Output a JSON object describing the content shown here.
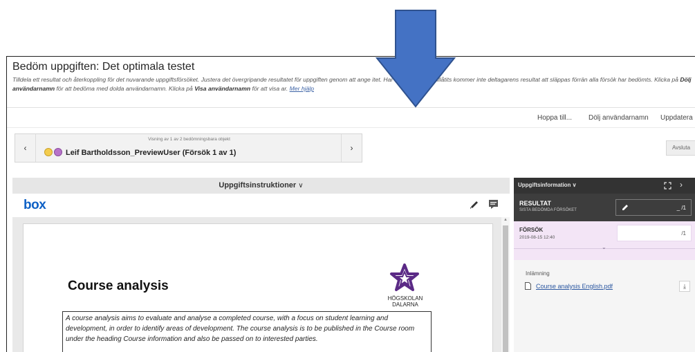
{
  "header": {
    "title": "Bedöm uppgiften: Det optimala testet",
    "description": {
      "part1": "Tilldela ett resultat och återkoppling för det nuvarande uppgiftsförsöket. Justera det övergripande resultatet för uppgiften genom att ange ",
      "part2": "itet. Har flera testförsök tillåtits kommer inte deltagarens resultat att släppas förrän alla försök har bedömts. Klicka på ",
      "bold1": "Dölj användarnamn",
      "part3": " för att bedöma med dolda användarnamn. Klicka på ",
      "bold2": "Visa användarnamn",
      "part4": " för att visa a",
      "part5": "r. ",
      "help_link": "Mer hjälp"
    }
  },
  "toolbar": {
    "jump_to": "Hoppa till...",
    "hide_names": "Dölj användarnamn",
    "update": "Uppdatera"
  },
  "navigator": {
    "count_text": "Visning av 1 av 2 bedömningsbara objekt",
    "user": "Leif Bartholdsson_PreviewUser (Försök 1 av 1)",
    "prev_glyph": "‹",
    "next_glyph": "›"
  },
  "finish_button": "Avsluta",
  "instructions": {
    "label": "Uppgiftsinstruktioner",
    "caret": "∨"
  },
  "viewer": {
    "logo": "box",
    "document": {
      "title": "Course analysis",
      "logo_text_line1": "HÖGSKOLAN",
      "logo_text_line2": "DALARNA",
      "body": "A course analysis aims to evaluate and analyse a completed course, with a focus on student learning and development, in order to identify areas of development. The course analysis is to be published in the Course room under the heading Course information and also be passed on to interested parties."
    }
  },
  "side_panel": {
    "title": "Uppgiftsinformation ∨",
    "next_glyph": "›",
    "result": {
      "label": "RESULTAT",
      "sublabel": "SISTA BEDÖMDA FÖRSÖKET",
      "value": "_ /1"
    },
    "attempt": {
      "label": "FÖRSÖK",
      "date": "2019-08-15 12:40",
      "value": "/1",
      "caret": "⌄"
    },
    "submission": {
      "label": "Inlämning",
      "file": "Course analysis English.pdf",
      "download_glyph": "⤓"
    }
  },
  "colors": {
    "arrow_fill": "#4472c4",
    "arrow_stroke": "#2f528f",
    "box_blue": "#0f61c5",
    "panel_dark": "#333333",
    "attempt_bg": "#f3e5f6",
    "logo_purple": "#5b2a86"
  }
}
